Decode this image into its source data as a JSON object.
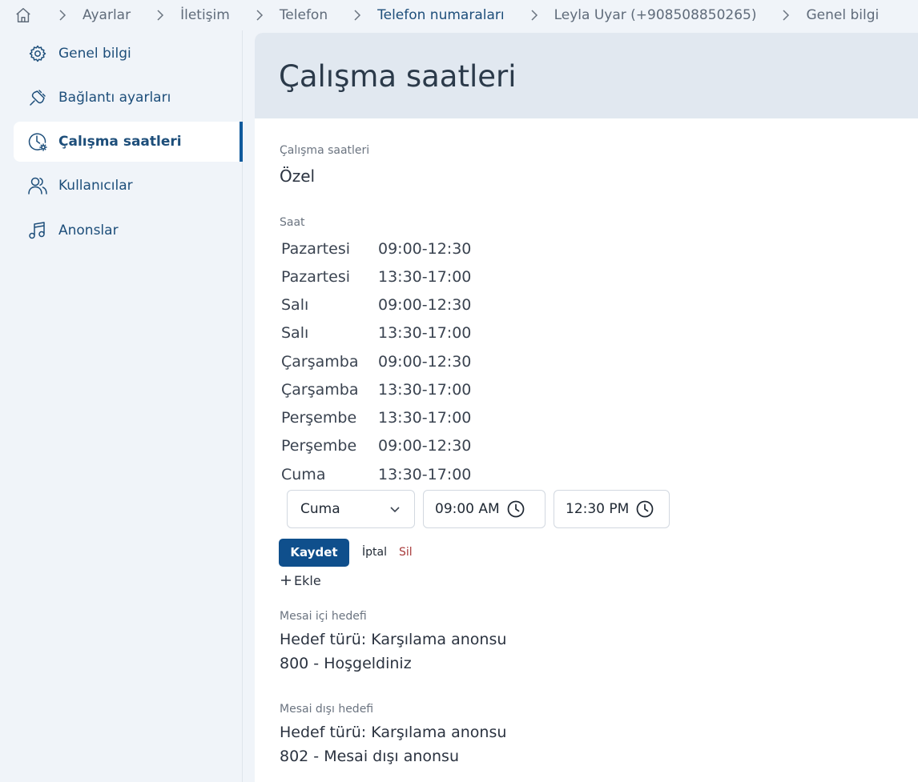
{
  "breadcrumb": {
    "items": [
      "Ayarlar",
      "İletişim",
      "Telefon",
      "Telefon numaraları",
      "Leyla Uyar (+908508850265)",
      "Genel bilgi"
    ]
  },
  "sidebar": {
    "items": [
      {
        "label": "Genel bilgi",
        "icon": "gear-icon"
      },
      {
        "label": "Bağlantı ayarları",
        "icon": "plug-icon"
      },
      {
        "label": "Çalışma saatleri",
        "icon": "clock-settings-icon",
        "active": true
      },
      {
        "label": "Kullanıcılar",
        "icon": "users-icon"
      },
      {
        "label": "Anonslar",
        "icon": "music-icon"
      }
    ]
  },
  "main": {
    "title": "Çalışma saatleri",
    "working_hours_label": "Çalışma saatleri",
    "working_hours_value": "Özel",
    "hours_label": "Saat",
    "schedule": [
      {
        "day": "Pazartesi",
        "time": "09:00-12:30"
      },
      {
        "day": "Pazartesi",
        "time": "13:30-17:00"
      },
      {
        "day": "Salı",
        "time": "09:00-12:30"
      },
      {
        "day": "Salı",
        "time": "13:30-17:00"
      },
      {
        "day": "Çarşamba",
        "time": "09:00-12:30"
      },
      {
        "day": "Çarşamba",
        "time": "13:30-17:00"
      },
      {
        "day": "Perşembe",
        "time": "13:30-17:00"
      },
      {
        "day": "Perşembe",
        "time": "09:00-12:30"
      },
      {
        "day": "Cuma",
        "time": "13:30-17:00"
      }
    ],
    "editor": {
      "day_select": "Cuma",
      "start_time": "09:00 AM",
      "end_time": "12:30 PM",
      "save_label": "Kaydet",
      "cancel_label": "İptal",
      "delete_label": "Sil",
      "add_label": "Ekle"
    },
    "in_hours_label": "Mesai içi hedefi",
    "in_hours_type": "Hedef türü: Karşılama anonsu",
    "in_hours_target": "800 - Hoşgeldiniz",
    "out_hours_label": "Mesai dışı hedefi",
    "out_hours_type": "Hedef türü: Karşılama anonsu",
    "out_hours_target": "802 - Mesai dışı anonsu"
  },
  "colors": {
    "accent": "#0f4f8c",
    "link": "#1d4e7a",
    "delete": "#a83a3a",
    "header_bg": "#e1e8f0"
  }
}
